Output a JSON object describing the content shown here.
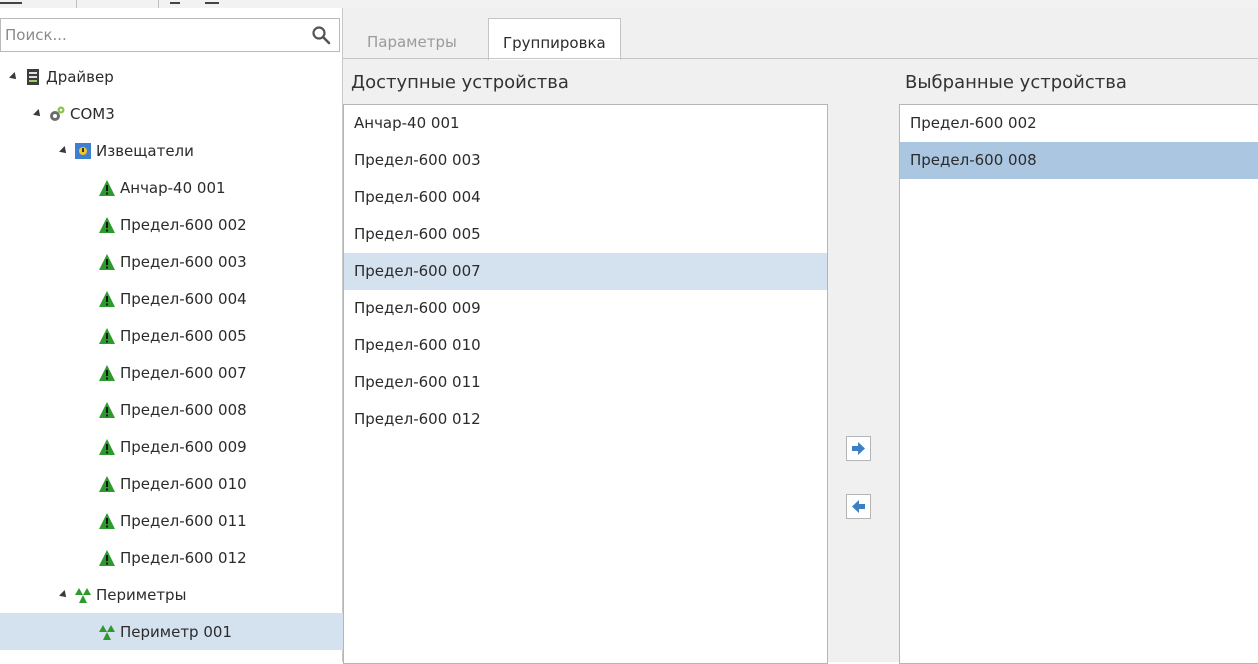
{
  "search": {
    "placeholder": "Поиск..."
  },
  "tree": {
    "nodes": [
      {
        "label": "Драйвер",
        "icon": "server-icon"
      },
      {
        "label": "COM3",
        "icon": "gear-network-icon"
      },
      {
        "label": "Извещатели",
        "icon": "detector-group-icon"
      },
      {
        "label": "Анчар-40 001",
        "icon": "warning-triangle-icon"
      },
      {
        "label": "Предел-600 002",
        "icon": "warning-triangle-icon"
      },
      {
        "label": "Предел-600 003",
        "icon": "warning-triangle-icon"
      },
      {
        "label": "Предел-600 004",
        "icon": "warning-triangle-icon"
      },
      {
        "label": "Предел-600 005",
        "icon": "warning-triangle-icon"
      },
      {
        "label": "Предел-600 007",
        "icon": "warning-triangle-icon"
      },
      {
        "label": "Предел-600 008",
        "icon": "warning-triangle-icon"
      },
      {
        "label": "Предел-600 009",
        "icon": "warning-triangle-icon"
      },
      {
        "label": "Предел-600 010",
        "icon": "warning-triangle-icon"
      },
      {
        "label": "Предел-600 011",
        "icon": "warning-triangle-icon"
      },
      {
        "label": "Предел-600 012",
        "icon": "warning-triangle-icon"
      },
      {
        "label": "Периметры",
        "icon": "perimeter-group-icon"
      },
      {
        "label": "Периметр 001",
        "icon": "perimeter-icon"
      }
    ],
    "selected": "Периметр 001"
  },
  "tabs": [
    {
      "label": "Параметры",
      "active": false
    },
    {
      "label": "Группировка",
      "active": true
    }
  ],
  "available": {
    "title": "Доступные устройства",
    "items": [
      "Анчар-40 001",
      "Предел-600 003",
      "Предел-600 004",
      "Предел-600 005",
      "Предел-600 007",
      "Предел-600 009",
      "Предел-600 010",
      "Предел-600 011",
      "Предел-600 012"
    ],
    "highlighted": "Предел-600 007"
  },
  "selected_devices": {
    "title": "Выбранные устройства",
    "items": [
      "Предел-600 002",
      "Предел-600 008"
    ],
    "highlighted": "Предел-600 008"
  },
  "buttons": {
    "add_icon": "arrow-right-icon",
    "remove_icon": "arrow-left-icon"
  },
  "colors": {
    "selection_light": "#d4e1ee",
    "selection_blue": "#aac6e1",
    "warning_green": "#2e9a2e",
    "arrow_blue": "#3b7fc4"
  }
}
